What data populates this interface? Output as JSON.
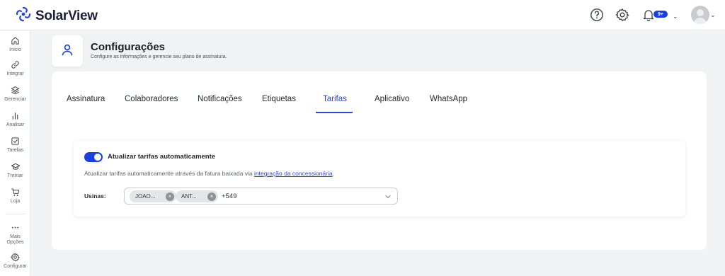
{
  "brand": {
    "name": "SolarView"
  },
  "topbar": {
    "help_icon": "help-circle-icon",
    "settings_icon": "gear-icon",
    "notifications": {
      "icon": "bell-icon",
      "badge": "9+"
    },
    "user_menu_icon": "avatar"
  },
  "sidebar": {
    "items": [
      {
        "label": "Início",
        "icon": "home-icon"
      },
      {
        "label": "Integrar",
        "icon": "link-icon"
      },
      {
        "label": "Gerenciar",
        "icon": "layers-icon"
      },
      {
        "label": "Analisar",
        "icon": "bar-chart-icon"
      },
      {
        "label": "Tarefas",
        "icon": "check-square-icon"
      },
      {
        "label": "Treinar",
        "icon": "graduation-cap-icon"
      },
      {
        "label": "Loja",
        "icon": "cart-icon"
      },
      {
        "label": "Mais Opções",
        "icon": "more-horizontal-icon"
      },
      {
        "label": "Configurar",
        "icon": "gear-icon"
      }
    ]
  },
  "header": {
    "icon": "user-icon",
    "title": "Configurações",
    "subtitle": "Configure as informações e gerencie seu plano de assinatura."
  },
  "tabs": [
    {
      "label": "Assinatura",
      "active": false
    },
    {
      "label": "Colaboradores",
      "active": false
    },
    {
      "label": "Notificações",
      "active": false
    },
    {
      "label": "Etiquetas",
      "active": false
    },
    {
      "label": "Tarifas",
      "active": true
    },
    {
      "label": "Aplicativo",
      "active": false
    },
    {
      "label": "WhatsApp",
      "active": false
    }
  ],
  "tariffs": {
    "toggle_label": "Atualizar tarifas automaticamente",
    "toggle_on": true,
    "description_prefix": "Atualizar tarifas automaticamente através da fatura baixada via ",
    "description_link": "integração da concessionária",
    "description_suffix": ".",
    "usinas_label": "Usinas:",
    "chips": [
      "JOAO...",
      "ANT..."
    ],
    "more_count": "+549"
  },
  "colors": {
    "accent": "#2b47d9",
    "toggle": "#1a3fe0",
    "background": "#f1f2f4"
  }
}
